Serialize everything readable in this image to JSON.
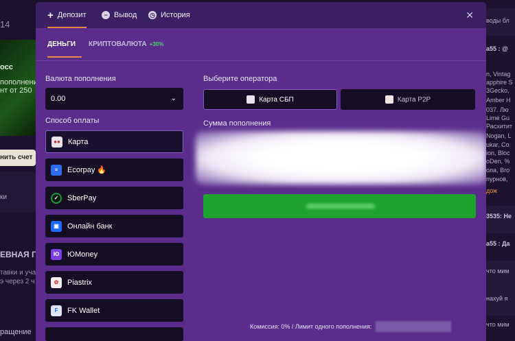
{
  "background": {
    "left": {
      "number": "14",
      "promo_title": "осс",
      "promo_line1": "пополнени",
      "promo_line2": "нт от 250",
      "cta_label": "нить счет",
      "cta_row_text": "ки",
      "headline": "ЕВНАЯ ГО",
      "small1": "тавки и уча",
      "small2": "э через 2 ч",
      "bottom": "ращение"
    },
    "right": {
      "lines": [
        "воды бл",
        "а55 : @",
        "n, Vintag",
        "apphire S",
        "3Gecko,",
        "Amber H",
        "037. Лю",
        "Lime Gu",
        "Расхитит",
        "Nogan, L",
        "ukar, Co",
        "ion, Bloc",
        "oDen, %",
        "ола, Bro",
        "пурнов,",
        "дож",
        "3535: Не",
        "а55 : Да",
        "что мим",
        "нахуй я",
        "что мим"
      ]
    }
  },
  "modal": {
    "tabs": [
      {
        "label": "Депозит",
        "icon": "plus-icon"
      },
      {
        "label": "Вывод",
        "icon": "minus-icon"
      },
      {
        "label": "История",
        "icon": "clock-icon"
      }
    ],
    "close_icon": "close-icon",
    "sub_tabs": {
      "money": "ДЕНЬГИ",
      "crypto": "КРИПТОВАЛЮТА",
      "crypto_bonus": "+30%"
    },
    "currency_label": "Валюта пополнения",
    "currency_value": "0.00",
    "payment_label": "Способ оплаты",
    "methods": [
      {
        "label": "Карта",
        "icon": "visa-card-icon",
        "color": "#e8e3ea"
      },
      {
        "label": "Ecorpay 🔥",
        "icon": "ecorpay-icon",
        "color": "#2f6df0"
      },
      {
        "label": "SberPay",
        "icon": "sberpay-icon",
        "color": "#1a9a3a"
      },
      {
        "label": "Онлайн банк",
        "icon": "online-bank-icon",
        "color": "#1f6bff"
      },
      {
        "label": "ЮMoney",
        "icon": "yumoney-icon",
        "color": "#7b3fe4"
      },
      {
        "label": "Piastrix",
        "icon": "piastrix-icon",
        "color": "#f5f0f0"
      },
      {
        "label": "FK Wallet",
        "icon": "fk-wallet-icon",
        "color": "#dfe6f3"
      }
    ],
    "operator_label": "Выберите оператора",
    "operators": [
      {
        "label": "Карта СБП",
        "icon": "sbp-icon"
      },
      {
        "label": "Карта P2P",
        "icon": "p2p-card-icon"
      }
    ],
    "amount_label": "Сумма пополнения",
    "footer_text": "Комиссия: 0% / Лимит одного пополнения:"
  },
  "colors": {
    "modal_bg": "#5a2d8c",
    "header_bg": "#3b2063",
    "accent_orange": "#e98a44",
    "submit_green": "#1fa32f",
    "bonus_green": "#4fd46b"
  }
}
